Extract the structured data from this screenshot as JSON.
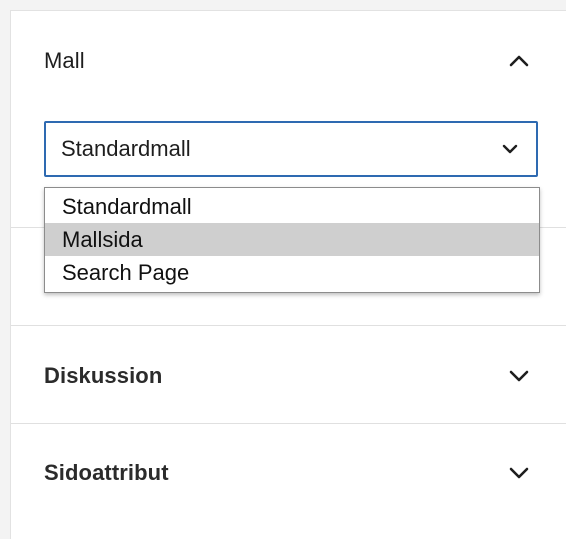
{
  "template_panel": {
    "title": "Mall",
    "toggle_icon": "chevron-up-icon",
    "select": {
      "value": "Standardmall",
      "icon": "chevron-down-icon",
      "options": [
        "Standardmall",
        "Mallsida",
        "Search Page"
      ],
      "highlighted": "Mallsida"
    }
  },
  "discussion_panel": {
    "title": "Diskussion",
    "toggle_icon": "chevron-down-icon"
  },
  "page_attributes_panel": {
    "title": "Sidoattribut",
    "toggle_icon": "chevron-down-icon"
  },
  "colors": {
    "focus_border": "#2e6ab1",
    "highlight_option": "#cfcfcf"
  }
}
